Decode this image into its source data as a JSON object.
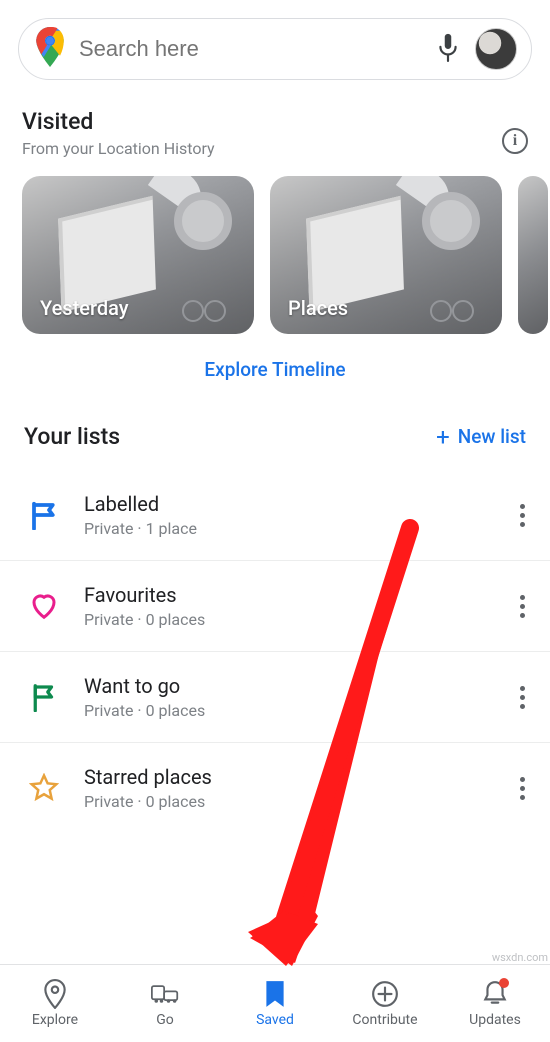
{
  "search": {
    "placeholder": "Search here"
  },
  "visited": {
    "title": "Visited",
    "subtitle": "From your Location History",
    "cards": [
      {
        "label": "Yesterday"
      },
      {
        "label": "Places"
      },
      {
        "label": ""
      }
    ],
    "explore_link": "Explore Timeline"
  },
  "lists": {
    "title": "Your lists",
    "new_list_label": "New list",
    "items": [
      {
        "name": "Labelled",
        "sub": "Private · 1 place"
      },
      {
        "name": "Favourites",
        "sub": "Private · 0 places"
      },
      {
        "name": "Want to go",
        "sub": "Private · 0 places"
      },
      {
        "name": "Starred places",
        "sub": "Private · 0 places"
      }
    ]
  },
  "bottom_nav": {
    "items": [
      {
        "label": "Explore"
      },
      {
        "label": "Go"
      },
      {
        "label": "Saved"
      },
      {
        "label": "Contribute"
      },
      {
        "label": "Updates"
      }
    ],
    "active_index": 2,
    "badge_index": 4
  },
  "watermark": "wsxdn.com"
}
